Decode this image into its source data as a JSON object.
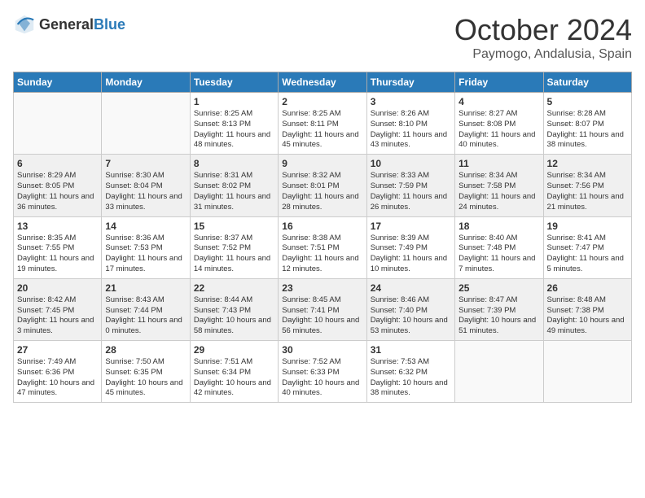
{
  "header": {
    "logo_general": "General",
    "logo_blue": "Blue",
    "month_year": "October 2024",
    "location": "Paymogo, Andalusia, Spain"
  },
  "columns": [
    "Sunday",
    "Monday",
    "Tuesday",
    "Wednesday",
    "Thursday",
    "Friday",
    "Saturday"
  ],
  "weeks": [
    {
      "days": [
        {
          "num": "",
          "empty": true
        },
        {
          "num": "",
          "empty": true
        },
        {
          "num": "1",
          "sunrise": "8:25 AM",
          "sunset": "8:13 PM",
          "daylight": "11 hours and 48 minutes."
        },
        {
          "num": "2",
          "sunrise": "8:25 AM",
          "sunset": "8:11 PM",
          "daylight": "11 hours and 45 minutes."
        },
        {
          "num": "3",
          "sunrise": "8:26 AM",
          "sunset": "8:10 PM",
          "daylight": "11 hours and 43 minutes."
        },
        {
          "num": "4",
          "sunrise": "8:27 AM",
          "sunset": "8:08 PM",
          "daylight": "11 hours and 40 minutes."
        },
        {
          "num": "5",
          "sunrise": "8:28 AM",
          "sunset": "8:07 PM",
          "daylight": "11 hours and 38 minutes."
        }
      ]
    },
    {
      "days": [
        {
          "num": "6",
          "sunrise": "8:29 AM",
          "sunset": "8:05 PM",
          "daylight": "11 hours and 36 minutes."
        },
        {
          "num": "7",
          "sunrise": "8:30 AM",
          "sunset": "8:04 PM",
          "daylight": "11 hours and 33 minutes."
        },
        {
          "num": "8",
          "sunrise": "8:31 AM",
          "sunset": "8:02 PM",
          "daylight": "11 hours and 31 minutes."
        },
        {
          "num": "9",
          "sunrise": "8:32 AM",
          "sunset": "8:01 PM",
          "daylight": "11 hours and 28 minutes."
        },
        {
          "num": "10",
          "sunrise": "8:33 AM",
          "sunset": "7:59 PM",
          "daylight": "11 hours and 26 minutes."
        },
        {
          "num": "11",
          "sunrise": "8:34 AM",
          "sunset": "7:58 PM",
          "daylight": "11 hours and 24 minutes."
        },
        {
          "num": "12",
          "sunrise": "8:34 AM",
          "sunset": "7:56 PM",
          "daylight": "11 hours and 21 minutes."
        }
      ]
    },
    {
      "days": [
        {
          "num": "13",
          "sunrise": "8:35 AM",
          "sunset": "7:55 PM",
          "daylight": "11 hours and 19 minutes."
        },
        {
          "num": "14",
          "sunrise": "8:36 AM",
          "sunset": "7:53 PM",
          "daylight": "11 hours and 17 minutes."
        },
        {
          "num": "15",
          "sunrise": "8:37 AM",
          "sunset": "7:52 PM",
          "daylight": "11 hours and 14 minutes."
        },
        {
          "num": "16",
          "sunrise": "8:38 AM",
          "sunset": "7:51 PM",
          "daylight": "11 hours and 12 minutes."
        },
        {
          "num": "17",
          "sunrise": "8:39 AM",
          "sunset": "7:49 PM",
          "daylight": "11 hours and 10 minutes."
        },
        {
          "num": "18",
          "sunrise": "8:40 AM",
          "sunset": "7:48 PM",
          "daylight": "11 hours and 7 minutes."
        },
        {
          "num": "19",
          "sunrise": "8:41 AM",
          "sunset": "7:47 PM",
          "daylight": "11 hours and 5 minutes."
        }
      ]
    },
    {
      "days": [
        {
          "num": "20",
          "sunrise": "8:42 AM",
          "sunset": "7:45 PM",
          "daylight": "11 hours and 3 minutes."
        },
        {
          "num": "21",
          "sunrise": "8:43 AM",
          "sunset": "7:44 PM",
          "daylight": "11 hours and 0 minutes."
        },
        {
          "num": "22",
          "sunrise": "8:44 AM",
          "sunset": "7:43 PM",
          "daylight": "10 hours and 58 minutes."
        },
        {
          "num": "23",
          "sunrise": "8:45 AM",
          "sunset": "7:41 PM",
          "daylight": "10 hours and 56 minutes."
        },
        {
          "num": "24",
          "sunrise": "8:46 AM",
          "sunset": "7:40 PM",
          "daylight": "10 hours and 53 minutes."
        },
        {
          "num": "25",
          "sunrise": "8:47 AM",
          "sunset": "7:39 PM",
          "daylight": "10 hours and 51 minutes."
        },
        {
          "num": "26",
          "sunrise": "8:48 AM",
          "sunset": "7:38 PM",
          "daylight": "10 hours and 49 minutes."
        }
      ]
    },
    {
      "days": [
        {
          "num": "27",
          "sunrise": "7:49 AM",
          "sunset": "6:36 PM",
          "daylight": "10 hours and 47 minutes."
        },
        {
          "num": "28",
          "sunrise": "7:50 AM",
          "sunset": "6:35 PM",
          "daylight": "10 hours and 45 minutes."
        },
        {
          "num": "29",
          "sunrise": "7:51 AM",
          "sunset": "6:34 PM",
          "daylight": "10 hours and 42 minutes."
        },
        {
          "num": "30",
          "sunrise": "7:52 AM",
          "sunset": "6:33 PM",
          "daylight": "10 hours and 40 minutes."
        },
        {
          "num": "31",
          "sunrise": "7:53 AM",
          "sunset": "6:32 PM",
          "daylight": "10 hours and 38 minutes."
        },
        {
          "num": "",
          "empty": true
        },
        {
          "num": "",
          "empty": true
        }
      ]
    }
  ],
  "labels": {
    "sunrise": "Sunrise:",
    "sunset": "Sunset:",
    "daylight": "Daylight:"
  }
}
